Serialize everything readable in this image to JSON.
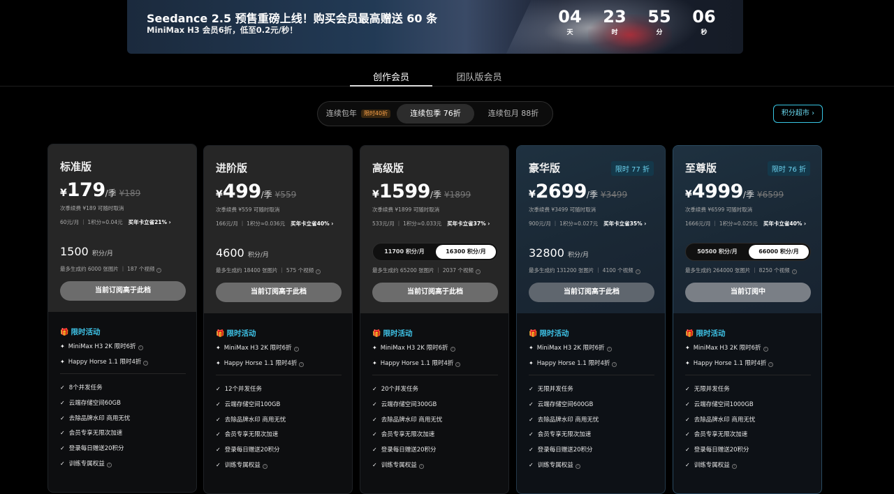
{
  "banner": {
    "title": "Seedance 2.5 预售重磅上线！购买会员最高赠送 60 条",
    "subtitle": "MiniMax H3 会员6折，低至0.2元/秒！",
    "countdown": [
      {
        "num": "04",
        "unit": "天"
      },
      {
        "num": "23",
        "unit": "时"
      },
      {
        "num": "55",
        "unit": "分"
      },
      {
        "num": "06",
        "unit": "秒"
      }
    ]
  },
  "tabs": [
    {
      "label": "创作会员",
      "active": true
    },
    {
      "label": "团队版会员",
      "active": false
    }
  ],
  "billing": {
    "options": [
      {
        "label": "连续包年",
        "tag": "限时40折"
      },
      {
        "label": "连续包季 76折",
        "active": true
      },
      {
        "label": "连续包月 88折"
      }
    ]
  },
  "mall_button": "积分超市 ›",
  "plans": [
    {
      "name": "标准版",
      "currency": "¥",
      "price": "179",
      "period": "/季",
      "orig": "¥189",
      "renew": "次季续费 ¥189 可随时取消",
      "rate": "60元/月 ｜ 1积分≈0.04元",
      "save": "买年卡立省21% ›",
      "credits": "1500",
      "credits_unit": "积分/月",
      "gen": "最多生成约  6000 张图片 ｜ 187 个视频",
      "button": "当前订阅高于此档",
      "promo_title": "限时活动",
      "promos": [
        "MiniMax H3 2K 限时6折",
        "Happy Horse 1.1 限时4折"
      ],
      "features": [
        "8个并发任务",
        "云端存储空间60GB",
        "去除品牌水印 商用无忧",
        "会员专享无限次加速",
        "登录每日赠送20积分",
        "训练专属权益"
      ]
    },
    {
      "name": "进阶版",
      "currency": "¥",
      "price": "499",
      "period": "/季",
      "orig": "¥559",
      "renew": "次季续费 ¥559 可随时取消",
      "rate": "166元/月 ｜ 1积分≈0.036元",
      "save": "买年卡立省40% ›",
      "credits": "4600",
      "credits_unit": "积分/月",
      "gen": "最多生成约  18400 张图片 ｜ 575 个视频",
      "button": "当前订阅高于此档",
      "promo_title": "限时活动",
      "promos": [
        "MiniMax H3 2K 限时6折",
        "Happy Horse 1.1 限时4折"
      ],
      "features": [
        "12个并发任务",
        "云端存储空间100GB",
        "去除品牌水印 商用无忧",
        "会员专享无限次加速",
        "登录每日赠送20积分",
        "训练专属权益"
      ]
    },
    {
      "name": "高级版",
      "currency": "¥",
      "price": "1599",
      "period": "/季",
      "orig": "¥1899",
      "renew": "次季续费 ¥1899 可随时取消",
      "rate": "533元/月 ｜ 1积分≈0.033元",
      "save": "买年卡立省37% ›",
      "seg": [
        "11700 积分/月",
        "16300 积分/月"
      ],
      "gen": "最多生成约  65200 张图片 ｜ 2037 个视频",
      "button": "当前订阅高于此档",
      "promo_title": "限时活动",
      "promos": [
        "MiniMax H3 2K 限时6折",
        "Happy Horse 1.1 限时4折"
      ],
      "features": [
        "20个并发任务",
        "云端存储空间300GB",
        "去除品牌水印 商用无忧",
        "会员专享无限次加速",
        "登录每日赠送20积分",
        "训练专属权益"
      ]
    },
    {
      "name": "豪华版",
      "discount": "限时 77 折",
      "currency": "¥",
      "price": "2699",
      "period": "/季",
      "orig": "¥3499",
      "renew": "次季续费 ¥3499 可随时取消",
      "rate": "900元/月 ｜ 1积分≈0.027元",
      "save": "买年卡立省35% ›",
      "credits": "32800",
      "credits_unit": "积分/月",
      "gen": "最多生成约  131200 张图片 ｜ 4100 个视频",
      "button": "当前订阅高于此档",
      "promo_title": "限时活动",
      "promos": [
        "MiniMax H3 2K 限时6折",
        "Happy Horse 1.1 限时4折"
      ],
      "features": [
        "无限并发任务",
        "云端存储空间600GB",
        "去除品牌水印 商用无忧",
        "会员专享无限次加速",
        "登录每日赠送20积分",
        "训练专属权益"
      ]
    },
    {
      "name": "至尊版",
      "discount": "限时 76 折",
      "currency": "¥",
      "price": "4999",
      "period": "/季",
      "orig": "¥6599",
      "renew": "次季续费 ¥6599 可随时取消",
      "rate": "1666元/月 ｜ 1积分≈0.025元",
      "save": "买年卡立省40% ›",
      "seg": [
        "50500 积分/月",
        "66000 积分/月"
      ],
      "gen": "最多生成约  264000 张图片 ｜ 8250 个视频",
      "button": "当前订阅中",
      "promo_title": "限时活动",
      "promos": [
        "MiniMax H3 2K 限时6折",
        "Happy Horse 1.1 限时4折"
      ],
      "features": [
        "无限并发任务",
        "云端存储空间1000GB",
        "去除品牌水印 商用无忧",
        "会员专享无限次加速",
        "登录每日赠送20积分",
        "训练专属权益"
      ]
    }
  ]
}
